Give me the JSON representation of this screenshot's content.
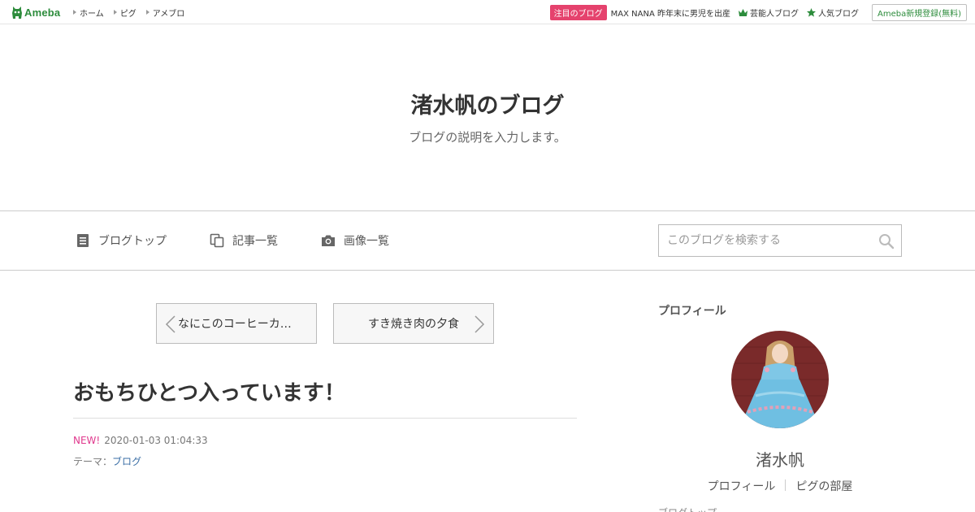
{
  "global_header": {
    "logo_text": "Ameba",
    "nav": [
      "ホーム",
      "ピグ",
      "アメブロ"
    ],
    "attention_badge": "注目のブログ",
    "attention_text": "MAX NANA 昨年末に男児を出産",
    "celeb_link": "芸能人ブログ",
    "popular_link": "人気ブログ",
    "register": "Ameba新規登録(無料)",
    "colors": {
      "brand": "#2d8c3c",
      "attention": "#e5426d"
    }
  },
  "blog": {
    "title": "渚水帆のブログ",
    "description": "ブログの説明を入力します。"
  },
  "blog_nav": {
    "items": [
      {
        "label": "ブログトップ",
        "icon": "document-icon"
      },
      {
        "label": "記事一覧",
        "icon": "copy-icon"
      },
      {
        "label": "画像一覧",
        "icon": "camera-icon"
      }
    ],
    "search_placeholder": "このブログを検索する"
  },
  "pager": {
    "prev": "なにこのコーヒーカ…",
    "next": "すき焼き肉の夕食"
  },
  "entry": {
    "title": "おもちひとつ入っています！",
    "new_label": "NEW!",
    "datetime": "2020-01-03 01:04:33",
    "theme_label": "テーマ：",
    "theme": "ブログ"
  },
  "sidebar": {
    "heading": "プロフィール",
    "nickname": "渚水帆",
    "links": [
      "プロフィール",
      "ピグの部屋"
    ],
    "cut_text": "ブログトップ"
  }
}
